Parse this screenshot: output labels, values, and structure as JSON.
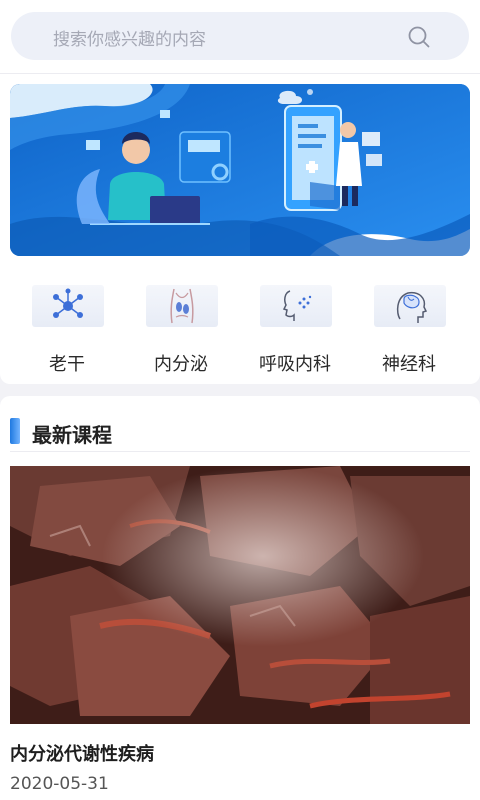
{
  "search": {
    "placeholder": "搜索你感兴趣的内容",
    "icon": "search-icon"
  },
  "banner": {
    "theme_color": "#1677d6"
  },
  "categories": [
    {
      "label": "老干",
      "icon": "network-node-icon"
    },
    {
      "label": "内分泌",
      "icon": "body-anatomy-icon"
    },
    {
      "label": "呼吸内科",
      "icon": "breathing-face-icon"
    },
    {
      "label": "神经科",
      "icon": "brain-head-icon"
    }
  ],
  "latest": {
    "section_title": "最新课程",
    "courses": [
      {
        "title": "内分泌代谢性疾病",
        "date": "2020-05-31"
      }
    ]
  }
}
